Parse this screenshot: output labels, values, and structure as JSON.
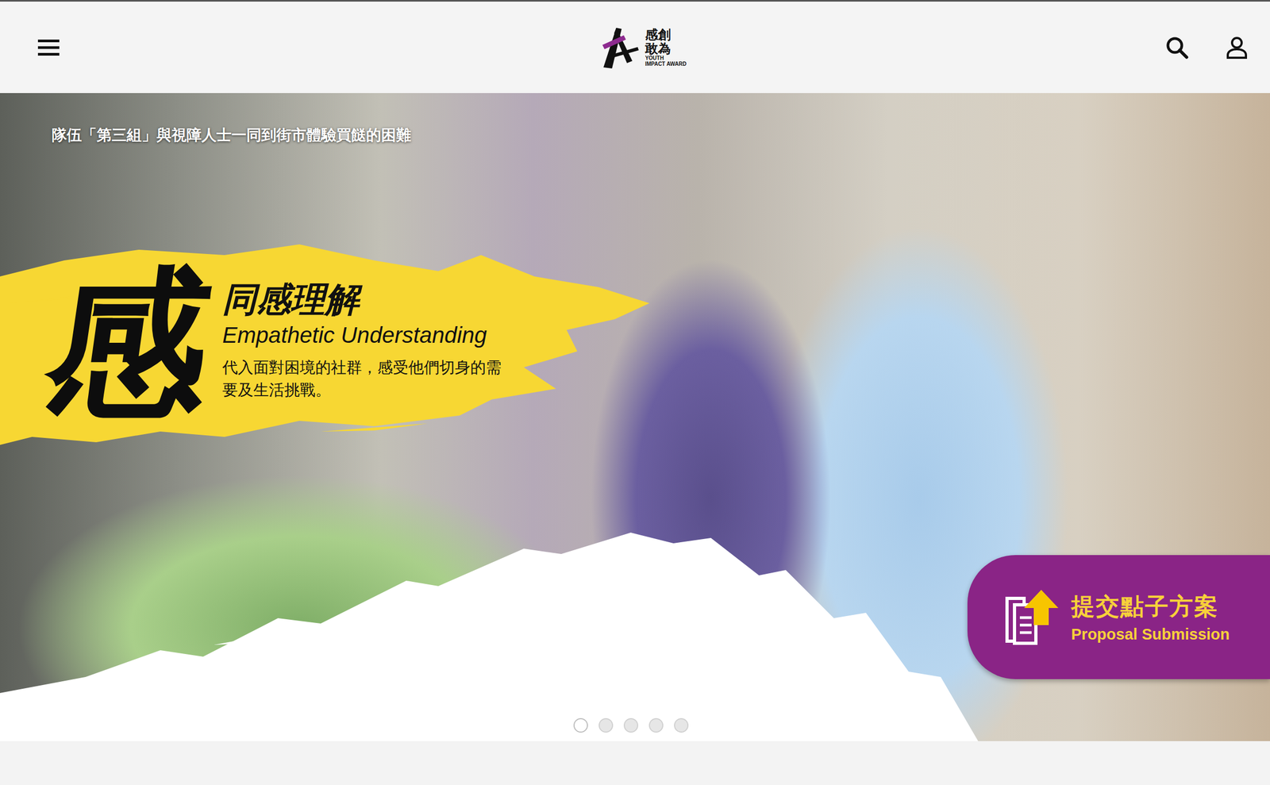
{
  "header": {
    "logo": {
      "chinese": "感創敢為",
      "english": [
        "YOUTH",
        "IMPACT AWARD"
      ]
    }
  },
  "slide": {
    "caption": "隊伍「第三組」與視障人士一同到街市體驗買餸的困難",
    "big_char": "感",
    "title": "同感理解",
    "subtitle": "Empathetic Understanding",
    "description": "代入面對困境的社群，感受他們切身的需要及生活挑戰。"
  },
  "proposal_button": {
    "title": "提交點子方案",
    "subtitle": "Proposal Submission"
  },
  "dots": [
    {
      "selected": true
    },
    {
      "selected": false
    },
    {
      "selected": false
    },
    {
      "selected": false
    },
    {
      "selected": false
    }
  ]
}
